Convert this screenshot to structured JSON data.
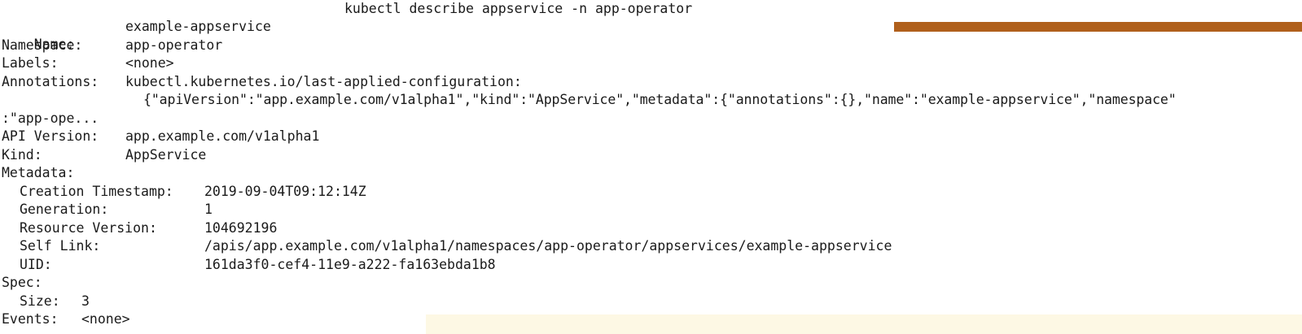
{
  "window": {
    "title": "kubectl describe appservice -n app-operator"
  },
  "colors": {
    "accent_bar": "#b0601c",
    "highlight_strip": "#fdf8e4",
    "text": "#1a1a1a",
    "background": "#ffffff"
  },
  "describe": {
    "name": {
      "key": "Name:",
      "value": "example-appservice"
    },
    "namespace": {
      "key": "Namespace:",
      "value": "app-operator"
    },
    "labels": {
      "key": "Labels:",
      "value": "<none>"
    },
    "annotations": {
      "key": "Annotations:",
      "annotation_key": "kubectl.kubernetes.io/last-applied-configuration:",
      "annotation_value_line1": "{\"apiVersion\":\"app.example.com/v1alpha1\",\"kind\":\"AppService\",\"metadata\":{\"annotations\":{},\"name\":\"example-appservice\",\"namespace\"",
      "annotation_value_line2": ":\"app-ope..."
    },
    "api_version": {
      "key": "API Version:",
      "value": "app.example.com/v1alpha1"
    },
    "kind": {
      "key": "Kind:",
      "value": "AppService"
    },
    "metadata": {
      "key": "Metadata:",
      "creation_timestamp": {
        "key": "Creation Timestamp:",
        "value": "2019-09-04T09:12:14Z"
      },
      "generation": {
        "key": "Generation:",
        "value": "1"
      },
      "resource_version": {
        "key": "Resource Version:",
        "value": "104692196"
      },
      "self_link": {
        "key": "Self Link:",
        "value": "/apis/app.example.com/v1alpha1/namespaces/app-operator/appservices/example-appservice"
      },
      "uid": {
        "key": "UID:",
        "value": "161da3f0-cef4-11e9-a222-fa163ebda1b8"
      }
    },
    "spec": {
      "key": "Spec:",
      "size": {
        "key": "Size:",
        "value": "3"
      }
    },
    "events": {
      "key": "Events:",
      "value": "<none>"
    }
  }
}
